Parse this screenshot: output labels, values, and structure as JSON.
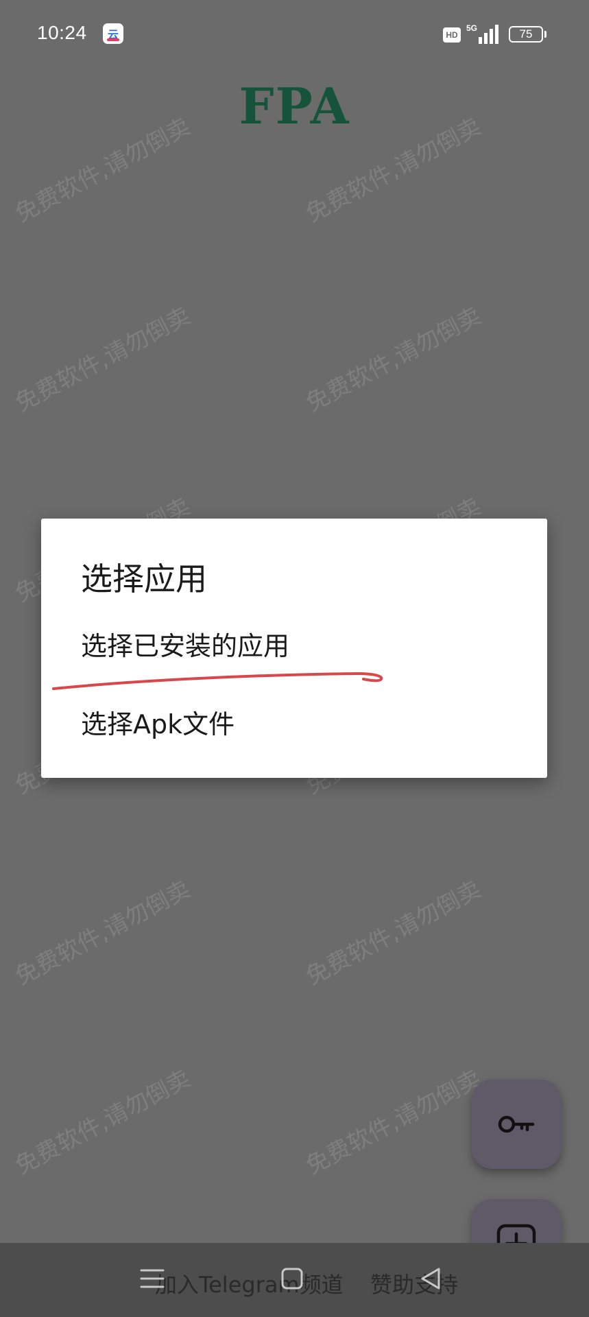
{
  "status_bar": {
    "time": "10:24",
    "network": "5G",
    "hd": "HD",
    "battery": "75"
  },
  "app": {
    "title": "FPA",
    "title_color": "#15533a"
  },
  "watermark_text": "免费软件,请勿倒卖",
  "dialog": {
    "title": "选择应用",
    "options": [
      {
        "label": "选择已安装的应用",
        "annotated": true
      },
      {
        "label": "选择Apk文件"
      }
    ],
    "annotation_color": "#d9474b"
  },
  "fabs": [
    {
      "icon": "key-icon"
    },
    {
      "icon": "add-box-icon"
    }
  ],
  "bottom_bar": {
    "telegram_label": "加入Telegram频道",
    "sponsor_label": "赞助支持"
  },
  "nav_bar": {
    "icons": [
      "menu-icon",
      "home-icon",
      "back-icon"
    ]
  }
}
